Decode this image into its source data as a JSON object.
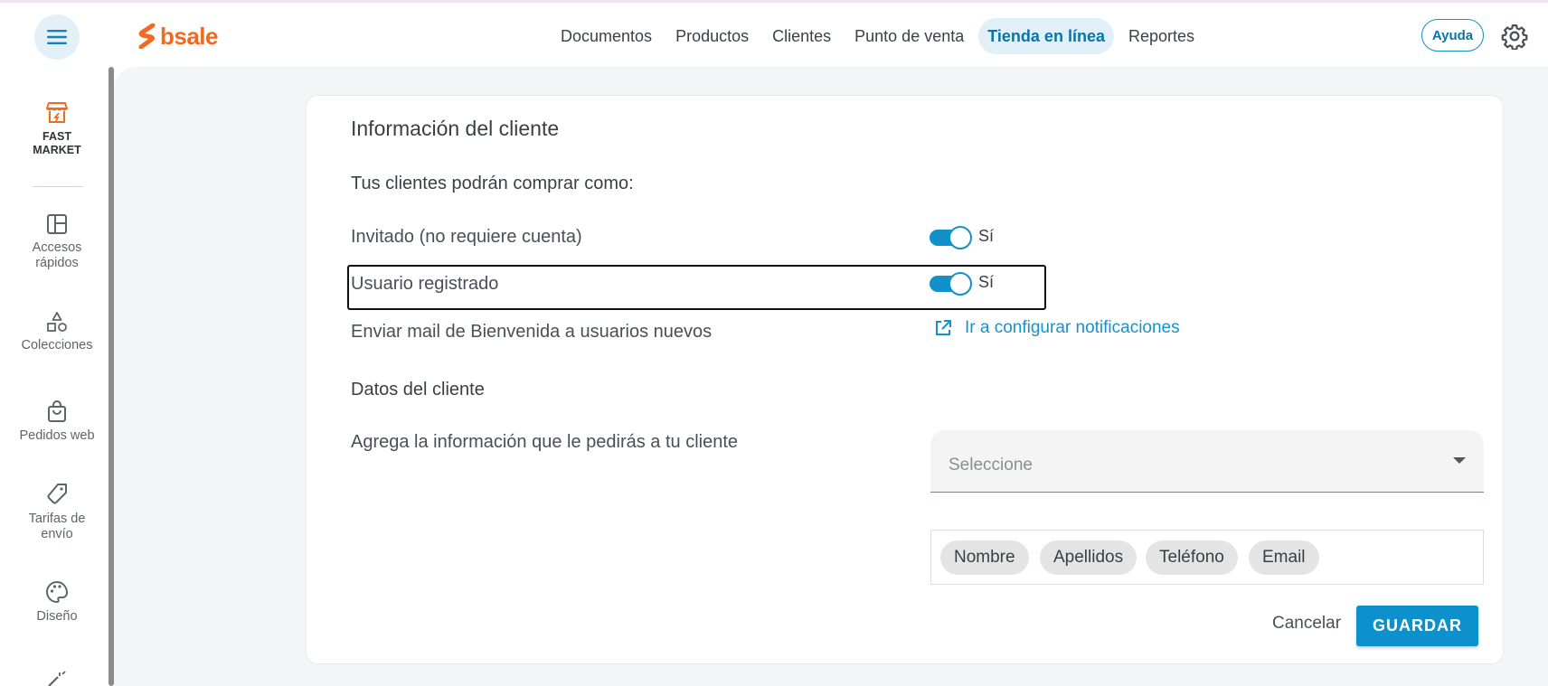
{
  "brand": {
    "name": "bsale",
    "color": "#f26a21"
  },
  "nav": {
    "items": [
      {
        "label": "Documentos"
      },
      {
        "label": "Productos"
      },
      {
        "label": "Clientes"
      },
      {
        "label": "Punto de venta"
      },
      {
        "label": "Tienda en línea",
        "active": true
      },
      {
        "label": "Reportes"
      }
    ],
    "help_label": "Ayuda"
  },
  "sidebar": {
    "store": {
      "line1": "FAST",
      "line2": "MARKET"
    },
    "items": [
      {
        "line1": "Accesos",
        "line2": "rápidos",
        "icon": "layout-icon"
      },
      {
        "line1": "Colecciones",
        "line2": "",
        "icon": "shapes-icon"
      },
      {
        "line1": "Pedidos web",
        "line2": "",
        "icon": "shopping-bag-icon"
      },
      {
        "line1": "Tarifas de",
        "line2": "envío",
        "icon": "tag-icon"
      },
      {
        "line1": "Diseño",
        "line2": "",
        "icon": "palette-icon"
      }
    ]
  },
  "customer_info": {
    "title": "Información del cliente",
    "subtitle": "Tus clientes podrán comprar como:",
    "guest": {
      "label": "Invitado (no requiere cuenta)",
      "toggle_text": "Sí",
      "enabled": true
    },
    "registered": {
      "label": "Usuario registrado",
      "toggle_text": "Sí",
      "enabled": true
    },
    "welcome_mail": {
      "label": "Enviar mail de Bienvenida a usuarios nuevos",
      "link": "Ir a configurar notificaciones"
    }
  },
  "customer_data": {
    "title": "Datos del cliente",
    "label": "Agrega la información que le pedirás a tu cliente",
    "select_placeholder": "Seleccione",
    "chips": [
      "Nombre",
      "Apellidos",
      "Teléfono",
      "Email"
    ]
  },
  "actions": {
    "cancel": "Cancelar",
    "save": "GUARDAR"
  },
  "colors": {
    "accent": "#1291c9",
    "active_nav_bg": "#e0eff8"
  }
}
